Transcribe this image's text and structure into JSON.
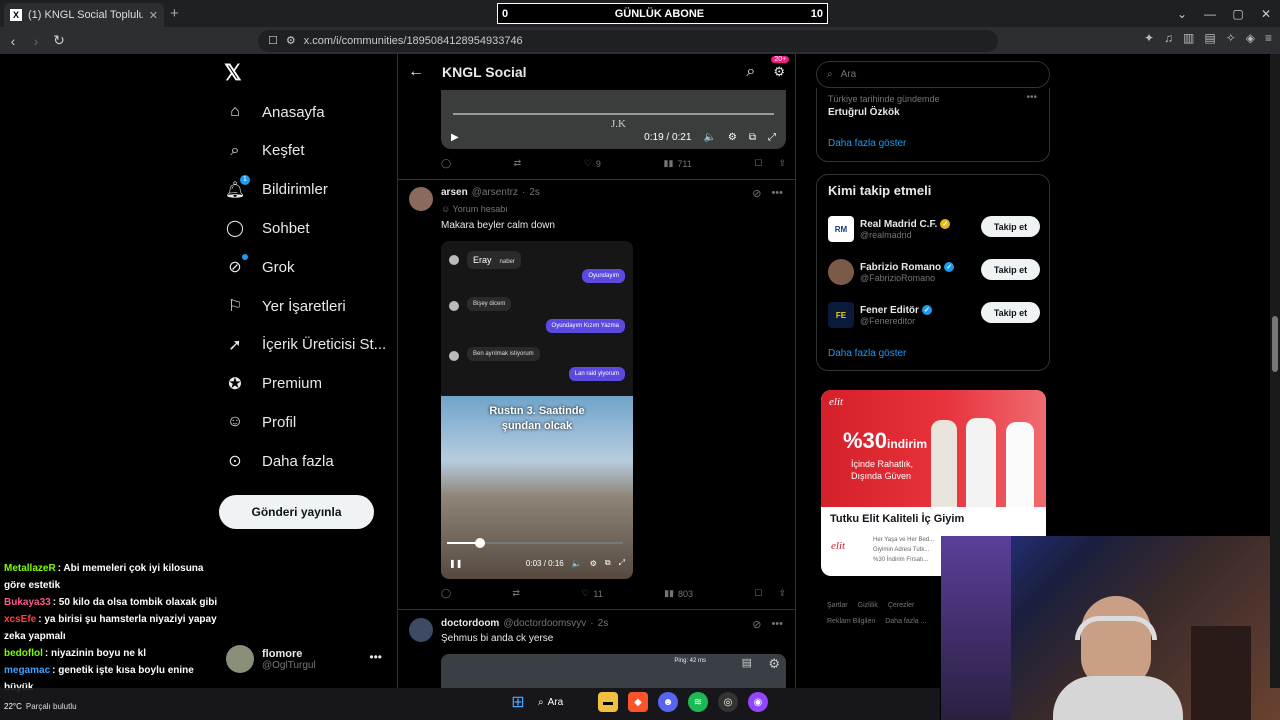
{
  "browser": {
    "tab_title": "(1) KNGL Social Topluluk / X",
    "url": "x.com/i/communities/1895084128954933746",
    "overlay": {
      "left": "0",
      "label": "GÜNLÜK ABONE",
      "right": "10"
    }
  },
  "nav": {
    "items": [
      {
        "label": "Anasayfa",
        "icon": "home-icon"
      },
      {
        "label": "Keşfet",
        "icon": "search-icon"
      },
      {
        "label": "Bildirimler",
        "icon": "bell-icon",
        "badge": "1"
      },
      {
        "label": "Sohbet",
        "icon": "chat-icon"
      },
      {
        "label": "Grok",
        "icon": "grok-icon"
      },
      {
        "label": "Yer İşaretleri",
        "icon": "bookmark-icon"
      },
      {
        "label": "İçerik Üreticisi St...",
        "icon": "rocket-icon"
      },
      {
        "label": "Premium",
        "icon": "premium-icon"
      },
      {
        "label": "Profil",
        "icon": "person-icon"
      },
      {
        "label": "Daha fazla",
        "icon": "more-circle-icon"
      }
    ],
    "post_button": "Gönderi yayınla",
    "account": {
      "name": "flomore",
      "handle": "@OglTurgul"
    }
  },
  "chat": [
    {
      "user": "MetallazeR",
      "color": "#7CFC00",
      "text": ": Abi memeleri çok iyi kilosuna göre estetik"
    },
    {
      "user": "Bukaya33",
      "color": "#ff5a8a",
      "text": ": 50 kilo da olsa tombik olaxak gibi"
    },
    {
      "user": "xcsEfe",
      "color": "#ff4040",
      "text": ": ya birisi şu hamsterla niyaziyi yapay zeka yapmalı"
    },
    {
      "user": "bedoflol",
      "color": "#7CFC00",
      "text": ": niyazinin boyu ne kl"
    },
    {
      "user": "megamac",
      "color": "#3aa0ff",
      "text": ": genetik işte kısa boylu enine büyük"
    }
  ],
  "center": {
    "title": "KNGL Social",
    "notif_badge": "20+",
    "video1": {
      "time": "0:19 / 0:21",
      "watermark": "J.K"
    },
    "post1_actions": {
      "likes": "9",
      "views": "711"
    },
    "post2": {
      "name": "arsen",
      "handle": "@arsentrz",
      "time": "2s",
      "tag": "Yorum hesabı",
      "text": "Makara beyler calm down",
      "chat_messages": [
        {
          "side": "l",
          "text": "naber",
          "name": "Eray"
        },
        {
          "side": "r",
          "text": "Oyundayım"
        },
        {
          "side": "l",
          "text": "Bişey dicem"
        },
        {
          "side": "r",
          "text": "Oyundayım Kızım Yazma"
        },
        {
          "side": "l",
          "text": "Ben ayrılmak istiyorum"
        },
        {
          "side": "r",
          "text": "Lan raid yiyorum"
        }
      ],
      "game_caption_1": "Rustın 3. Saatinde",
      "game_caption_2": "şundan olcak",
      "video_time": "0:03 / 0:16",
      "progress": 0.19,
      "likes": "11",
      "views": "803"
    },
    "post3": {
      "name": "doctordoom",
      "handle": "@doctordoomsvyv",
      "time": "2s",
      "text": "Şehmus bi anda ck yerse",
      "overlay_text": "Ping: 42 ms"
    }
  },
  "right": {
    "search_placeholder": "Ara",
    "trend": {
      "context": "Türkiye tarihinde gündemde",
      "name": "Ertuğrul Özkök",
      "more": "Daha fazla göster"
    },
    "who_to_follow": {
      "title": "Kimi takip etmeli",
      "accounts": [
        {
          "name": "Real Madrid C.F.",
          "handle": "@realmadrid",
          "verified_color": "#e2b719"
        },
        {
          "name": "Fabrizio Romano",
          "handle": "@FabrizioRomano",
          "verified_color": "#1d9bf0"
        },
        {
          "name": "Fener Editör",
          "handle": "@Fenereditor",
          "verified_color": "#1d9bf0"
        }
      ],
      "follow_label": "Takip et",
      "more": "Daha fazla göster"
    },
    "ad": {
      "brand": "elit",
      "discount": "%30",
      "discount_word": "indirim",
      "slogan1": "İçinde Rahatlık,",
      "slogan2": "Dışında Güven",
      "title": "Tutku Elit Kaliteli İç Giyim",
      "desc1": "Her Yaşa ve Her Bed...",
      "desc2": "Giyimin Adresi Tutk...",
      "desc3": "%30 İndirim Fırsatı..."
    },
    "footer": [
      "Şartlar",
      "Gizlilik",
      "Çerezler",
      "Reklam Bilgileri",
      "Daha fazla ..."
    ]
  },
  "taskbar": {
    "search": "Ara",
    "weather": "Parçalı bulutlu",
    "temp": "22°C"
  }
}
